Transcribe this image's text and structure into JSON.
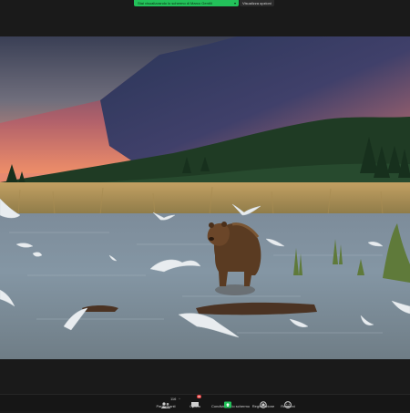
{
  "topbar": {
    "share_banner_label": "Stai visualizzando lo schermo di Marco Gentili",
    "view_options_label": "Visualizza opzioni"
  },
  "toolbar": {
    "items": [
      {
        "label": "Partecipanti",
        "icon": "participants-icon",
        "count": "116"
      },
      {
        "label": "Chatta",
        "icon": "chat-icon",
        "badge": "99"
      },
      {
        "label": "Condividere lo schermo",
        "icon": "share-screen-icon"
      },
      {
        "label": "Registrazione",
        "icon": "record-icon"
      },
      {
        "label": "Reazioni",
        "icon": "reactions-icon"
      }
    ]
  },
  "colors": {
    "share_green": "#23c15a",
    "toolbar_bg": "#161616",
    "badge_red": "#e23b3b"
  },
  "shared_content": {
    "description_icon": "bear-river-photo"
  }
}
